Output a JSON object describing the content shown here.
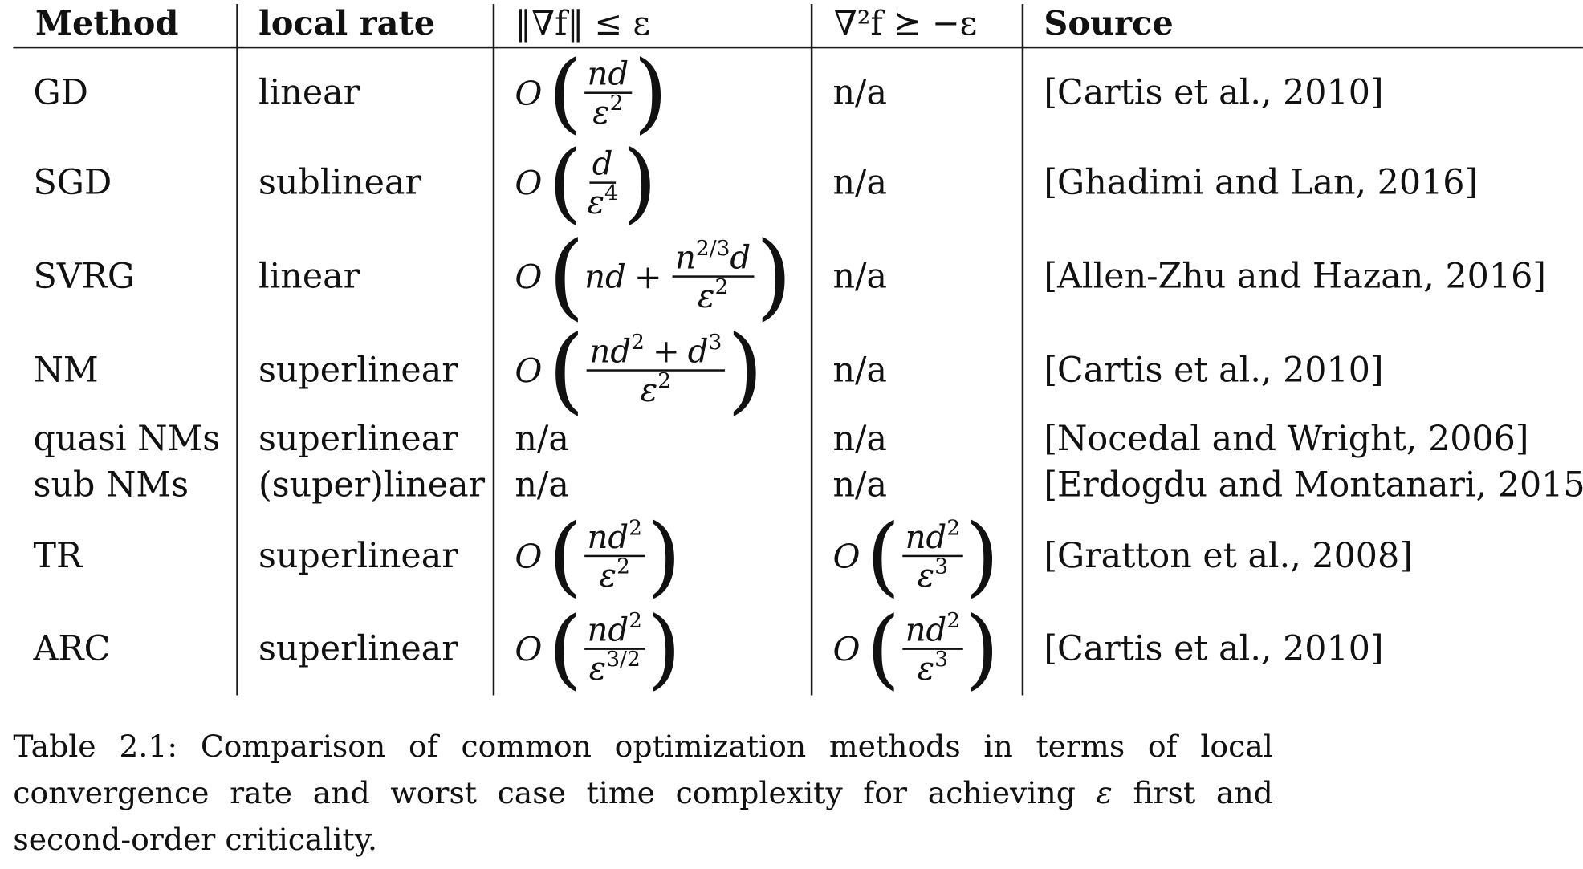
{
  "table": {
    "headers": {
      "method": "Method",
      "local_rate": "local rate",
      "grad": "‖∇f‖ ≤ ε",
      "hess": "∇²f ⪰ −ε",
      "source": "Source"
    },
    "rows": [
      {
        "method": "GD",
        "rate": "linear",
        "grad_num": "nd",
        "grad_den": "ε",
        "grad_den_exp": "2",
        "hess": "n/a",
        "source": "[Cartis et al., 2010]"
      },
      {
        "method": "SGD",
        "rate": "sublinear",
        "grad_num": "d",
        "grad_den": "ε",
        "grad_den_exp": "4",
        "hess": "n/a",
        "source": "[Ghadimi and Lan, 2016]"
      },
      {
        "method": "SVRG",
        "rate": "linear",
        "grad_pre": "nd",
        "grad_plus": "+",
        "grad_num": "n",
        "grad_num_exp": "2/3",
        "grad_num_tail": "d",
        "grad_den": "ε",
        "grad_den_exp": "2",
        "hess": "n/a",
        "source": "[Allen-Zhu and Hazan, 2016]"
      },
      {
        "method": "NM",
        "rate": "superlinear",
        "grad_num": "nd",
        "grad_num_exp": "2",
        "grad_plus": "+",
        "grad_num_tail": "d",
        "grad_num_tail_exp": "3",
        "grad_den": "ε",
        "grad_den_exp": "2",
        "hess": "n/a",
        "source": "[Cartis et al., 2010]"
      },
      {
        "method": "quasi NMs",
        "rate": "superlinear",
        "grad": "n/a",
        "hess": "n/a",
        "source": "[Nocedal and Wright, 2006]"
      },
      {
        "method": "sub NMs",
        "rate": "(super)linear",
        "grad": "n/a",
        "hess": "n/a",
        "source": "[Erdogdu and Montanari, 2015]"
      },
      {
        "method": "TR",
        "rate": "superlinear",
        "grad_num": "nd",
        "grad_num_exp": "2",
        "grad_den": "ε",
        "grad_den_exp": "2",
        "hess_num": "nd",
        "hess_num_exp": "2",
        "hess_den": "ε",
        "hess_den_exp": "3",
        "source": "[Gratton et al., 2008]"
      },
      {
        "method": "ARC",
        "rate": "superlinear",
        "grad_num": "nd",
        "grad_num_exp": "2",
        "grad_den": "ε",
        "grad_den_exp": "3/2",
        "hess_num": "nd",
        "hess_num_exp": "2",
        "hess_den": "ε",
        "hess_den_exp": "3",
        "source": "[Cartis et al., 2010]"
      }
    ],
    "big_o": "O",
    "lparen": "(",
    "rparen": ")"
  },
  "caption": {
    "text_before": "Table 2.1: Comparison of common optimization methods in terms of local convergence rate and worst case time complexity for achieving ",
    "epsilon": "ε",
    "text_after": " first and second-order criticality."
  }
}
